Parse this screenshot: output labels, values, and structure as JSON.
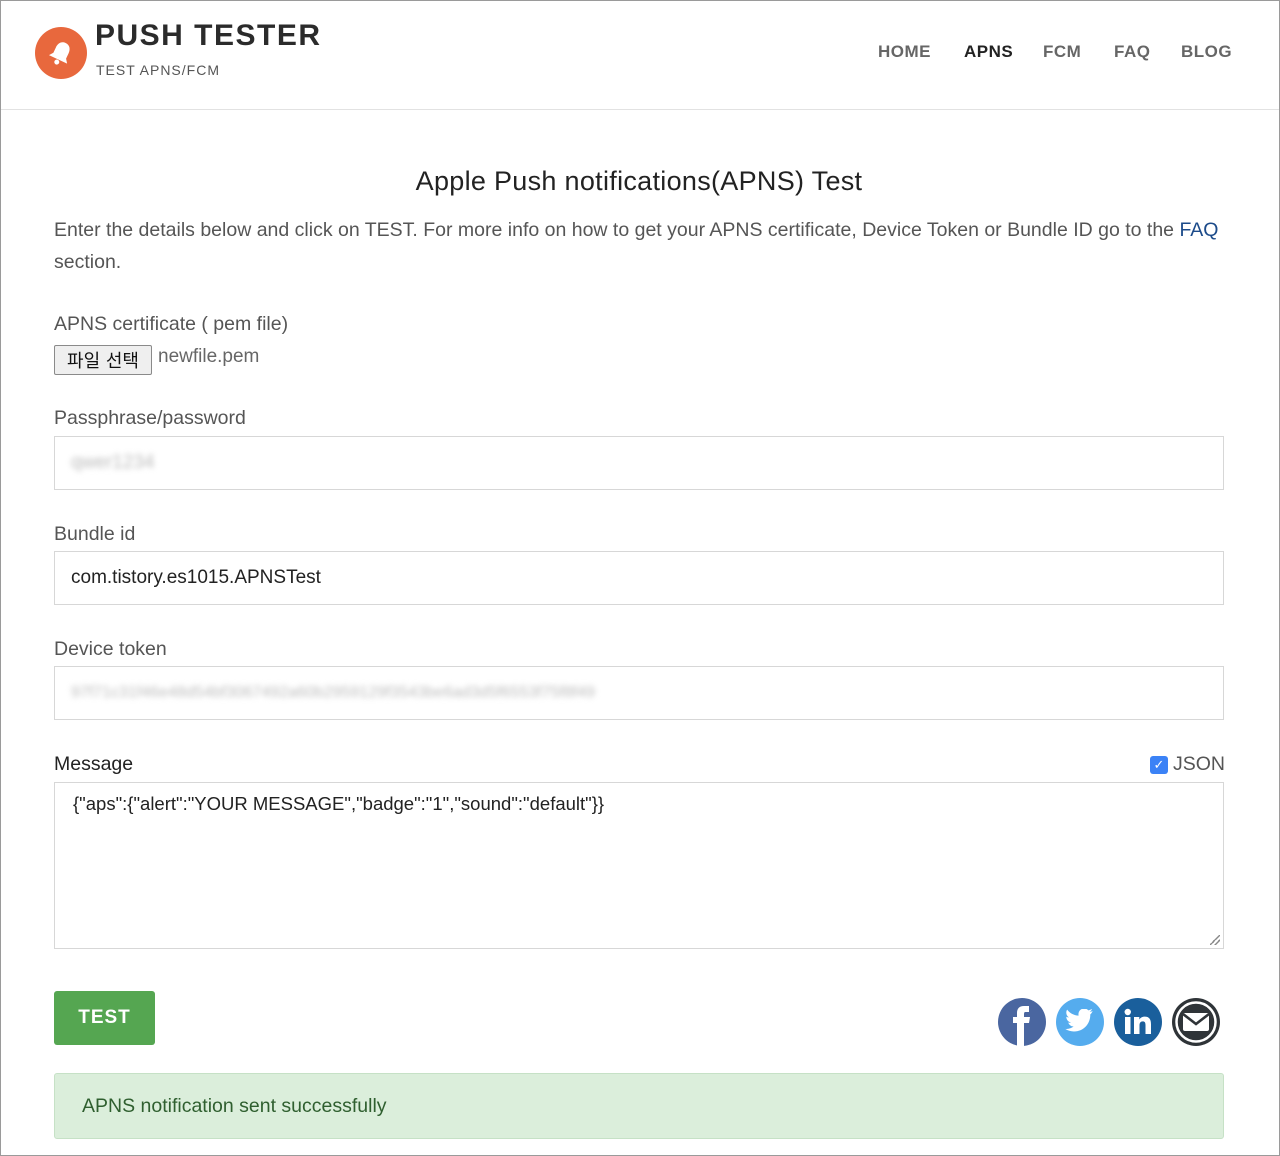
{
  "header": {
    "brand_title": "PUSH TESTER",
    "brand_subtitle": "TEST APNS/FCM",
    "logo_icon": "bell-icon",
    "logo_color": "#e8683d",
    "nav": [
      {
        "label": "HOME",
        "active": false
      },
      {
        "label": "APNS",
        "active": true
      },
      {
        "label": "FCM",
        "active": false
      },
      {
        "label": "FAQ",
        "active": false
      },
      {
        "label": "BLOG",
        "active": false
      }
    ]
  },
  "main": {
    "title": "Apple Push notifications(APNS) Test",
    "intro_text": "Enter the details below and click on TEST. For more info on how to get your APNS certificate, Device Token or Bundle ID go to the",
    "intro_link": "FAQ",
    "intro_suffix": " section.",
    "certificate": {
      "label": "APNS certificate ( pem file)",
      "button_label": "파일 선택",
      "file_name": "newfile.pem"
    },
    "passphrase": {
      "label": "Passphrase/password",
      "value": "qwer1234"
    },
    "bundle_id": {
      "label": "Bundle id",
      "value": "com.tistory.es1015.APNSTest"
    },
    "device_token": {
      "label": "Device token",
      "value": "97f71c31f46e48d54bf3067492a60b2959129f3543be6ad3d5f6553f75f8f49"
    },
    "message": {
      "label": "Message",
      "json_label": "JSON",
      "json_checked": true,
      "value": "{\"aps\":{\"alert\":\"YOUR MESSAGE\",\"badge\":\"1\",\"sound\":\"default\"}}"
    },
    "test_button": "TEST",
    "test_button_color": "#55a651",
    "social": [
      {
        "icon": "facebook-icon",
        "color": "#4a66a0"
      },
      {
        "icon": "twitter-icon",
        "color": "#55acee"
      },
      {
        "icon": "linkedin-icon",
        "color": "#1a5f9c"
      },
      {
        "icon": "email-icon",
        "color": "#2f3438"
      }
    ],
    "status_message": "APNS notification sent successfully",
    "status_color": "#dbeedb"
  }
}
